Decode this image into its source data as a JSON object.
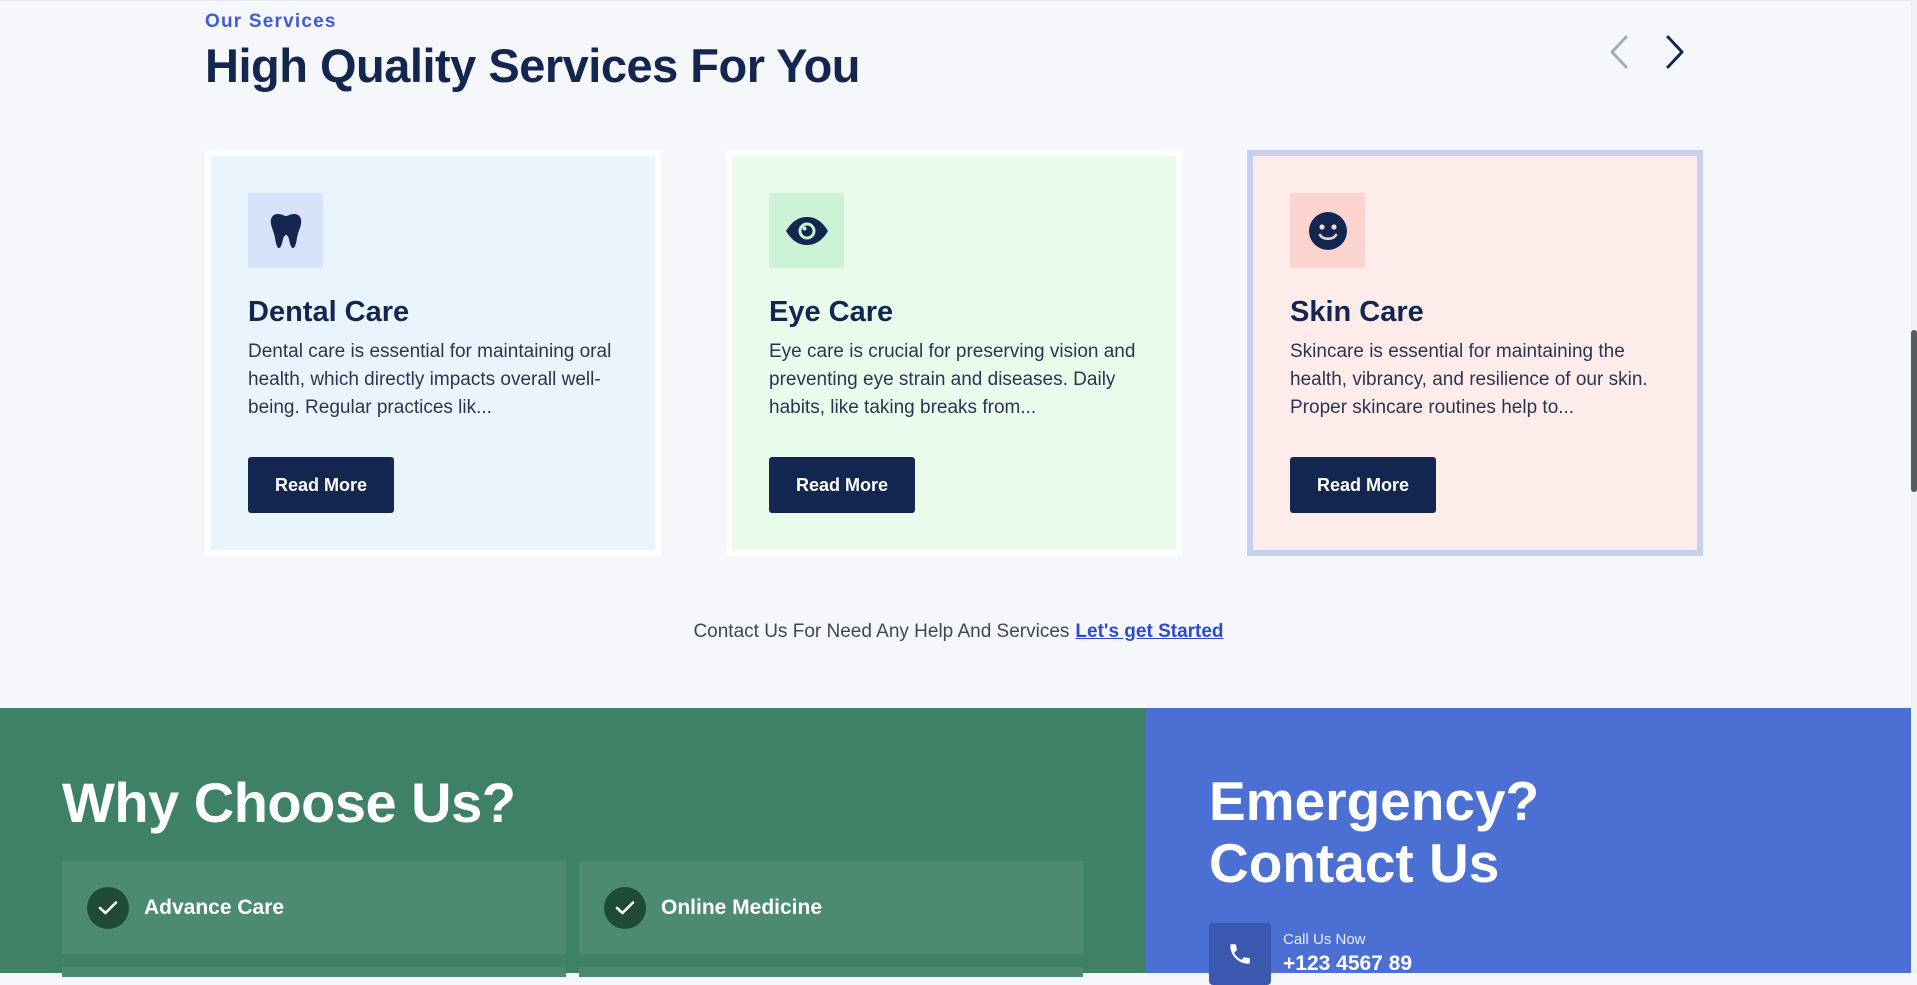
{
  "services": {
    "eyebrow": "Our Services",
    "title": "High Quality Services For You",
    "prev_icon": "chevron-left-icon",
    "next_icon": "chevron-right-icon",
    "cards": [
      {
        "icon": "tooth-icon",
        "title": "Dental Care",
        "text": "Dental care is essential for maintaining oral health, which directly impacts overall well-being. Regular practices lik...",
        "button": "Read More"
      },
      {
        "icon": "eye-icon",
        "title": "Eye Care",
        "text": "Eye care is crucial for preserving vision and preventing eye strain and diseases. Daily habits, like taking breaks from...",
        "button": "Read More"
      },
      {
        "icon": "smile-icon",
        "title": "Skin Care",
        "text": "Skincare is essential for maintaining the health, vibrancy, and resilience of our skin. Proper skincare routines help to...",
        "button": "Read More"
      }
    ],
    "help_text": "Contact Us For Need Any Help And Services",
    "help_link": "Let's get Started"
  },
  "why": {
    "title": "Why Choose Us?",
    "features": [
      {
        "icon": "check-icon",
        "label": "Advance Care"
      },
      {
        "icon": "check-icon",
        "label": "Online Medicine"
      }
    ]
  },
  "emergency": {
    "title_line1": "Emergency?",
    "title_line2": "Contact Us",
    "call_label": "Call Us Now",
    "call_number": "+123 4567 89",
    "phone_icon": "phone-icon"
  },
  "colors": {
    "navy": "#13264f",
    "accent_blue": "#3d5bd4",
    "green": "#3e8167",
    "emergency_blue": "#4b6fd3"
  }
}
